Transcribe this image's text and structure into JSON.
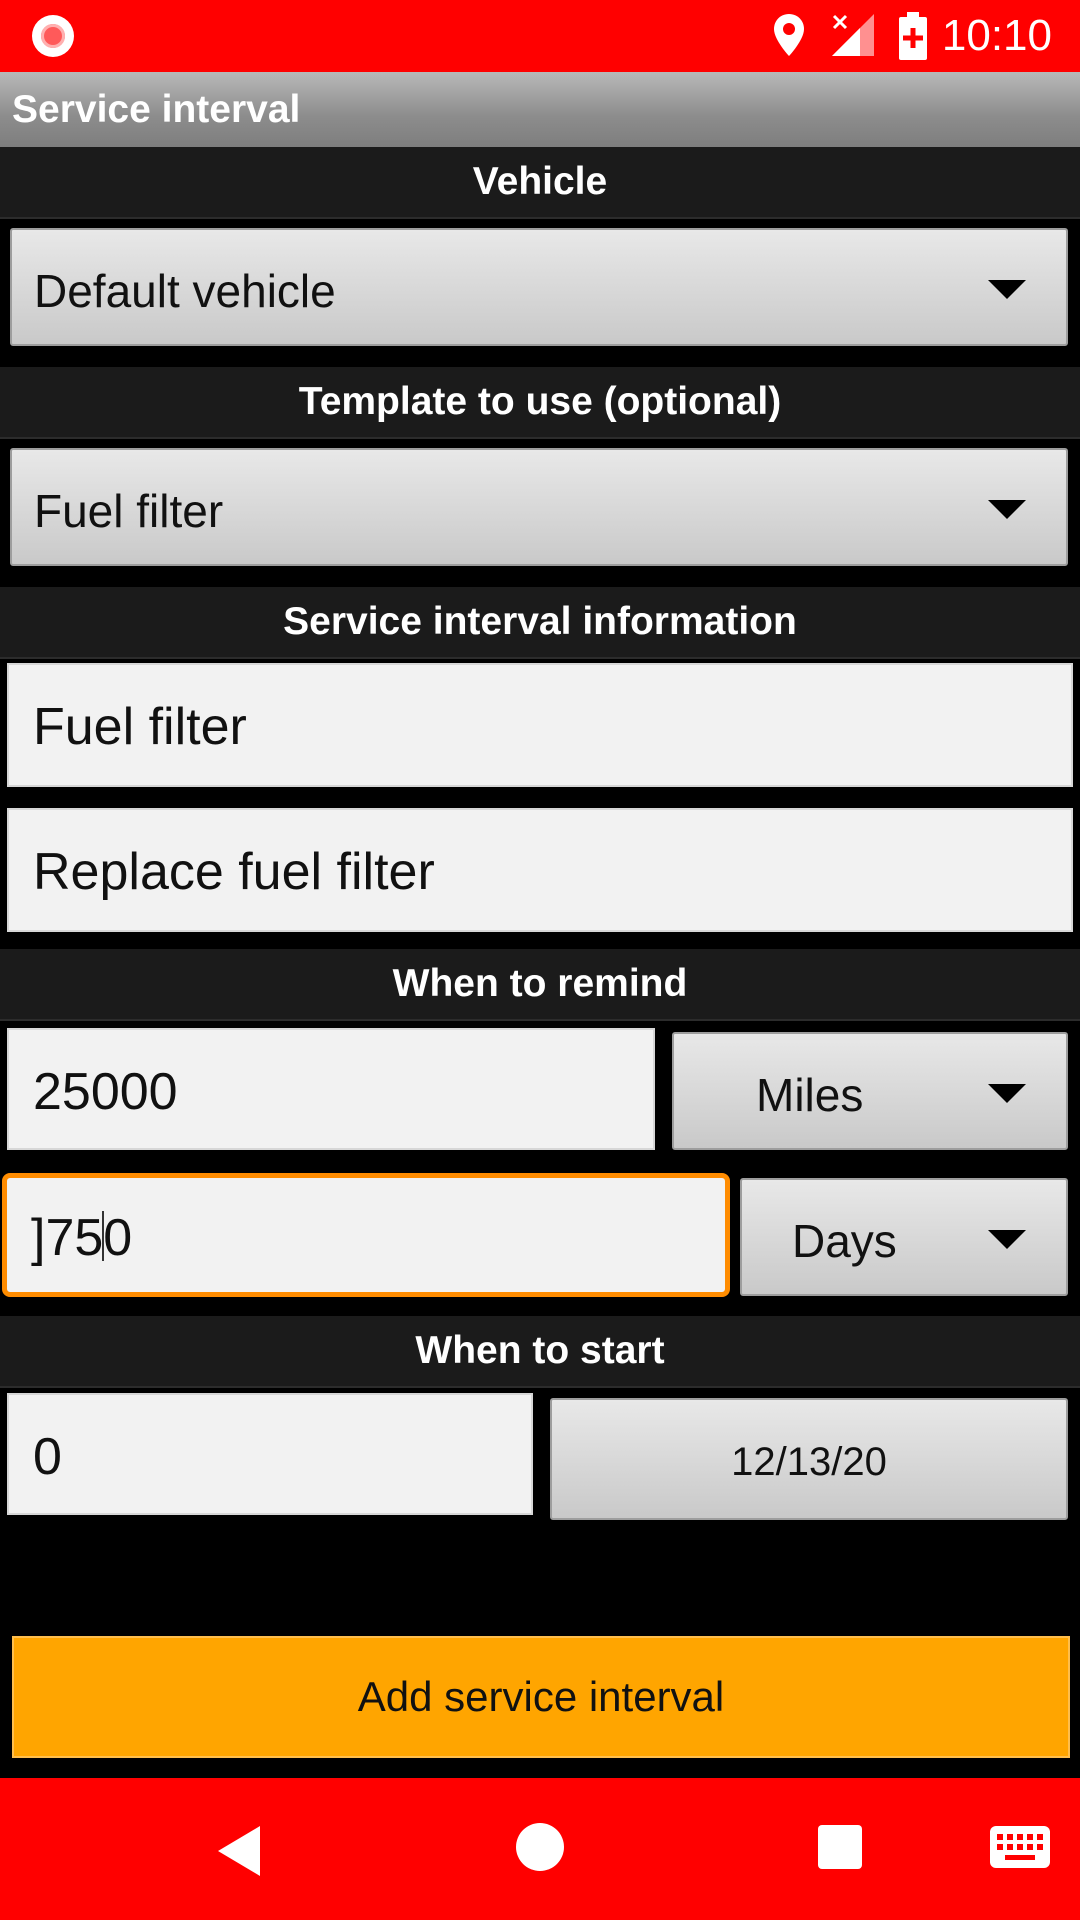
{
  "status_bar": {
    "time": "10:10",
    "icons": [
      "record-icon",
      "location-icon",
      "signal-off-icon",
      "battery-icon"
    ]
  },
  "app_bar": {
    "title": "Service interval"
  },
  "vehicle": {
    "header": "Vehicle",
    "selected": "Default vehicle"
  },
  "template": {
    "header": "Template to use (optional)",
    "selected": "Fuel filter"
  },
  "info": {
    "header": "Service interval information",
    "name_value": "Fuel filter",
    "description_value": "Replace fuel filter"
  },
  "remind": {
    "header": "When to remind",
    "distance_value": "25000",
    "distance_unit": "Miles",
    "time_value_before_caret": "]75",
    "time_value_after_caret": "0",
    "time_unit": "Days"
  },
  "start": {
    "header": "When to start",
    "odometer_value": "0",
    "date": "12/13/20"
  },
  "actions": {
    "add_label": "Add service interval"
  },
  "nav_bar": {
    "icons": [
      "back-icon",
      "home-icon",
      "recents-icon",
      "keyboard-icon"
    ]
  },
  "colors": {
    "status_bar": "#ff0000",
    "accent": "#ffa500",
    "focus": "#ff8c00",
    "section_bg": "#1b1b1b"
  }
}
